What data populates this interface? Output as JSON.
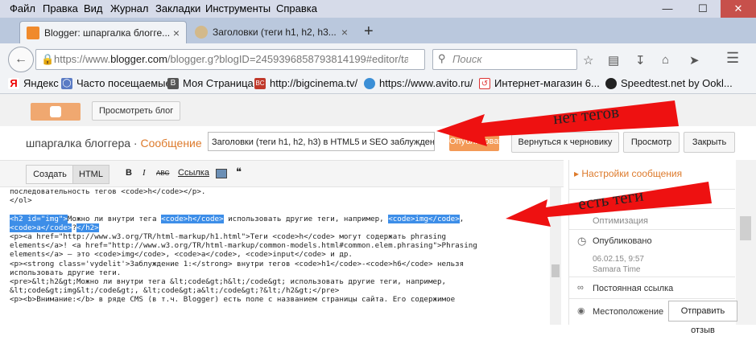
{
  "menu": [
    "Файл",
    "Правка",
    "Вид",
    "Журнал",
    "Закладки",
    "Инструменты",
    "Справка"
  ],
  "window_controls": {
    "minimize": "—",
    "maximize": "☐",
    "close": "✕"
  },
  "tabs": [
    {
      "title": "Blogger: шпаргалка блогге...",
      "close": "×",
      "active": true
    },
    {
      "title": "Заголовки (теги h1, h2, h3...",
      "close": "×",
      "active": false
    }
  ],
  "new_tab": "+",
  "nav": {
    "url_prefix": "https://www.",
    "url_domain": "blogger.com",
    "url_rest": "/blogger.g?blogID=2459396858793814199#editor/targe",
    "search_placeholder": "Поиск"
  },
  "bookmarks": [
    "Яндекс",
    "Часто посещаемые",
    "Моя Страница",
    "http://bigcinema.tv/",
    "https://www.avito.ru/",
    "Интернет-магазин 6...",
    "Speedtest.net by Ookl..."
  ],
  "blogger": {
    "view_blog": "Просмотреть блог",
    "blog_name": "шпаргалка блоггера",
    "separator": " · ",
    "section": "Сообщение",
    "post_title": "Заголовки (теги h1, h2, h3) в HTML5 и SEO заблуждения",
    "publish": "Опубликовать",
    "return_draft": "Вернуться к черновику",
    "preview": "Просмотр",
    "close": "Закрыть"
  },
  "editor": {
    "compose": "Создать",
    "html": "HTML",
    "bold": "B",
    "italic": "I",
    "strike": "ABC",
    "link": "Ссылка",
    "quote": "❝"
  },
  "code_lines": [
    [
      {
        "t": "последовательность тегов <code>h</code></p>.",
        "h": false
      }
    ],
    [
      {
        "t": "</ol>",
        "h": false
      }
    ],
    [
      {
        "t": "",
        "h": false
      }
    ],
    [
      {
        "t": "<h2 id=\"img\">",
        "h": true
      },
      {
        "t": "Можно ли внутри тега ",
        "h": false
      },
      {
        "t": "<code>h</code>",
        "h": true
      },
      {
        "t": " использовать другие теги, например, ",
        "h": false
      },
      {
        "t": "<code>img</code>",
        "h": true
      },
      {
        "t": ",",
        "h": false
      }
    ],
    [
      {
        "t": "<code>a</code>",
        "h": true
      },
      {
        "t": "?",
        "h": false
      },
      {
        "t": "</h2>",
        "h": true
      }
    ],
    [
      {
        "t": "<p><a href=\"http://www.w3.org/TR/html-markup/h1.html\">Теги <code>h</code> могут содержать phrasing",
        "h": false
      }
    ],
    [
      {
        "t": "elements</a>! <a href=\"http://www.w3.org/TR/html-markup/common-models.html#common.elem.phrasing\">Phrasing",
        "h": false
      }
    ],
    [
      {
        "t": "elements</a> — это <code>img</code>, <code>a</code>, <code>input</code> и др.",
        "h": false
      }
    ],
    [
      {
        "t": "<p><strong class='vydelit'>Заблуждение 1:</strong> внутри тегов <code>h1</code>-<code>h6</code> нельзя",
        "h": false
      }
    ],
    [
      {
        "t": "использовать другие теги.",
        "h": false
      }
    ],
    [
      {
        "t": "<pre>&lt;h2&gt;Можно ли внутри тега &lt;code&gt;h&lt;/code&gt; использовать другие теги, например,",
        "h": false
      }
    ],
    [
      {
        "t": "&lt;code&gt;img&lt;/code&gt;, &lt;code&gt;a&lt;/code&gt;?&lt;/h2&gt;</pre>",
        "h": false
      }
    ],
    [
      {
        "t": "<p><b>Внимание:</b> в ряде CMS (в т.ч. Blogger) есть поле с названием страницы сайта. Его содержимое",
        "h": false
      }
    ]
  ],
  "sidebar": {
    "settings": "Настройки сообщения",
    "optimization": "Оптимизация",
    "published": "Опубликовано",
    "date": "06.02.15, 9:57",
    "tz": "Samara Time",
    "permalink": "Постоянная ссылка",
    "location": "Местоположение",
    "feedback": "Отправить отзыв"
  },
  "annotations": {
    "top": "нет тегов",
    "bottom": "есть теги"
  },
  "colors": {
    "arrow": "#ee1111",
    "accent": "#dd7a2b",
    "highlight": "#3d8ee8"
  }
}
